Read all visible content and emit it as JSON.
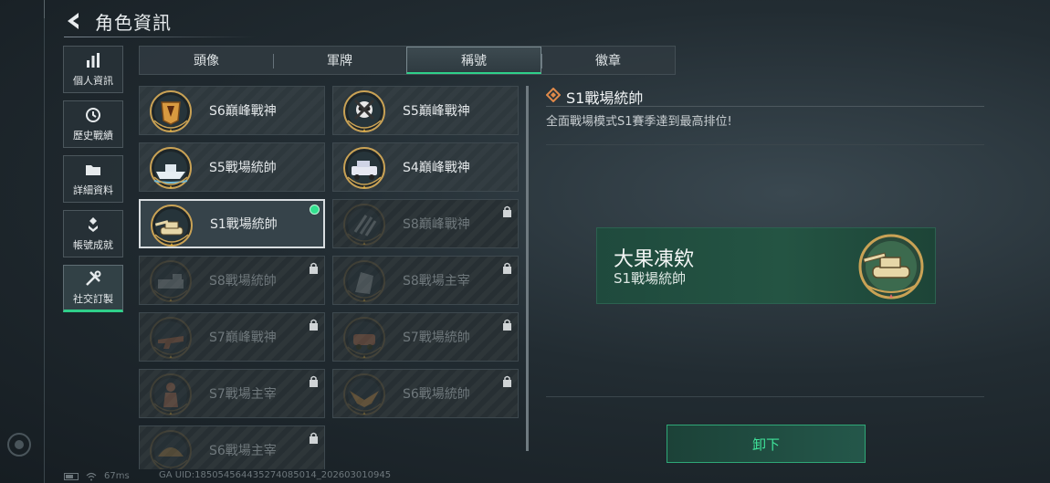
{
  "header": {
    "title": "角色資訊"
  },
  "nav": [
    {
      "label": "個人資訊",
      "icon": "bar-chart-icon",
      "active": false
    },
    {
      "label": "歷史戰績",
      "icon": "clock-icon",
      "active": false
    },
    {
      "label": "詳細資料",
      "icon": "folder-icon",
      "active": false
    },
    {
      "label": "帳號成就",
      "icon": "medal-icon",
      "active": false
    },
    {
      "label": "社交訂製",
      "icon": "tools-icon",
      "active": true
    }
  ],
  "tabs": [
    {
      "label": "頭像",
      "active": false
    },
    {
      "label": "軍牌",
      "active": false
    },
    {
      "label": "稱號",
      "active": true
    },
    {
      "label": "徽章",
      "active": false
    }
  ],
  "titles": [
    {
      "label": "S6巔峰戰神",
      "state": "unlocked",
      "emblem": "shield-emblem-icon"
    },
    {
      "label": "S5巔峰戰神",
      "state": "unlocked",
      "emblem": "skull-emblem-icon"
    },
    {
      "label": "S5戰場統帥",
      "state": "unlocked",
      "emblem": "boat-emblem-icon"
    },
    {
      "label": "S4巔峰戰神",
      "state": "unlocked",
      "emblem": "jeep-emblem-icon"
    },
    {
      "label": "S1戰場統帥",
      "state": "selected",
      "emblem": "tank-emblem-icon"
    },
    {
      "label": "S8巔峰戰神",
      "state": "locked",
      "emblem": "stripes-emblem-icon"
    },
    {
      "label": "S8戰場統帥",
      "state": "locked",
      "emblem": "truck-emblem-icon"
    },
    {
      "label": "S8戰場主宰",
      "state": "locked",
      "emblem": "building-emblem-icon"
    },
    {
      "label": "S7巔峰戰神",
      "state": "locked",
      "emblem": "gun-emblem-icon"
    },
    {
      "label": "S7戰場統帥",
      "state": "locked",
      "emblem": "vehicle-emblem-icon"
    },
    {
      "label": "S7戰場主宰",
      "state": "locked",
      "emblem": "soldier-emblem-icon"
    },
    {
      "label": "S6戰場統帥",
      "state": "locked",
      "emblem": "eagle-emblem-icon"
    },
    {
      "label": "S6戰場主宰",
      "state": "locked",
      "emblem": "dome-emblem-icon"
    }
  ],
  "detail": {
    "title": "S1戰場統帥",
    "description": "全面戰場模式S1賽季達到最高排位!",
    "player_name": "大果凍欸",
    "equipped_title": "S1戰場統帥",
    "unequip_label": "卸下"
  },
  "status": {
    "ping": "67ms",
    "uid": "GA UID:18505456443527408501​4_202603010945"
  },
  "colors": {
    "accent_green": "#2fd08a",
    "banner_green": "#245443",
    "gold": "#c9a255"
  }
}
